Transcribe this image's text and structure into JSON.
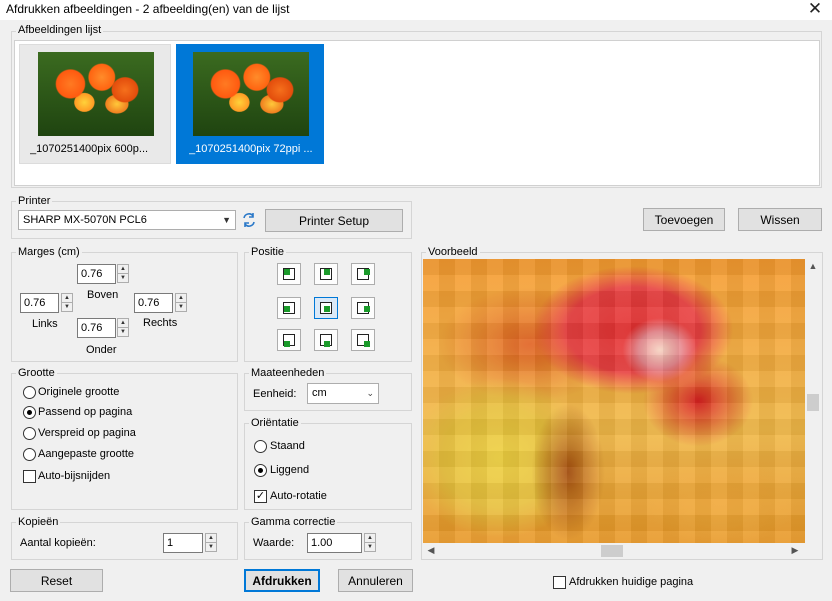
{
  "window": {
    "title": "Afdrukken afbeeldingen  -  2 afbeelding(en) van de lijst",
    "close_glyph": "✕"
  },
  "image_list": {
    "label": "Afbeeldingen lijst",
    "items": [
      {
        "label": "_1070251400pix 600p...",
        "selected": false
      },
      {
        "label": "_1070251400pix 72ppi ...",
        "selected": true
      }
    ]
  },
  "printer": {
    "label": "Printer",
    "selected": "SHARP MX-5070N PCL6",
    "setup_button": "Printer Setup",
    "refresh_icon": "refresh-icon"
  },
  "actions": {
    "add_button": "Toevoegen",
    "clear_button": "Wissen",
    "reset_button": "Reset",
    "print_button": "Afdrukken",
    "cancel_button": "Annuleren"
  },
  "margins": {
    "label": "Marges (cm)",
    "top": {
      "label": "Boven",
      "value": "0.76"
    },
    "left": {
      "label": "Links",
      "value": "0.76"
    },
    "right": {
      "label": "Rechts",
      "value": "0.76"
    },
    "bottom": {
      "label": "Onder",
      "value": "0.76"
    }
  },
  "position": {
    "label": "Positie",
    "selected": "center"
  },
  "size": {
    "label": "Grootte",
    "options": [
      "Originele grootte",
      "Passend op pagina",
      "Verspreid op pagina",
      "Aangepaste grootte"
    ],
    "selected_index": 1,
    "auto_crop_label": "Auto-bijsnijden",
    "auto_crop_checked": false
  },
  "units": {
    "label": "Maateenheden",
    "field_label": "Eenheid:",
    "value": "cm"
  },
  "orientation": {
    "label": "Oriëntatie",
    "portrait": "Staand",
    "landscape": "Liggend",
    "selected": "landscape",
    "auto_rotate_label": "Auto-rotatie",
    "auto_rotate_checked": true
  },
  "copies": {
    "label": "Kopieën",
    "field_label": "Aantal kopieën:",
    "value": "1"
  },
  "gamma": {
    "label": "Gamma correctie",
    "field_label": "Waarde:",
    "value": "1.00"
  },
  "preview": {
    "label": "Voorbeeld",
    "print_current_page_label": "Afdrukken huidige pagina",
    "print_current_page_checked": false
  }
}
